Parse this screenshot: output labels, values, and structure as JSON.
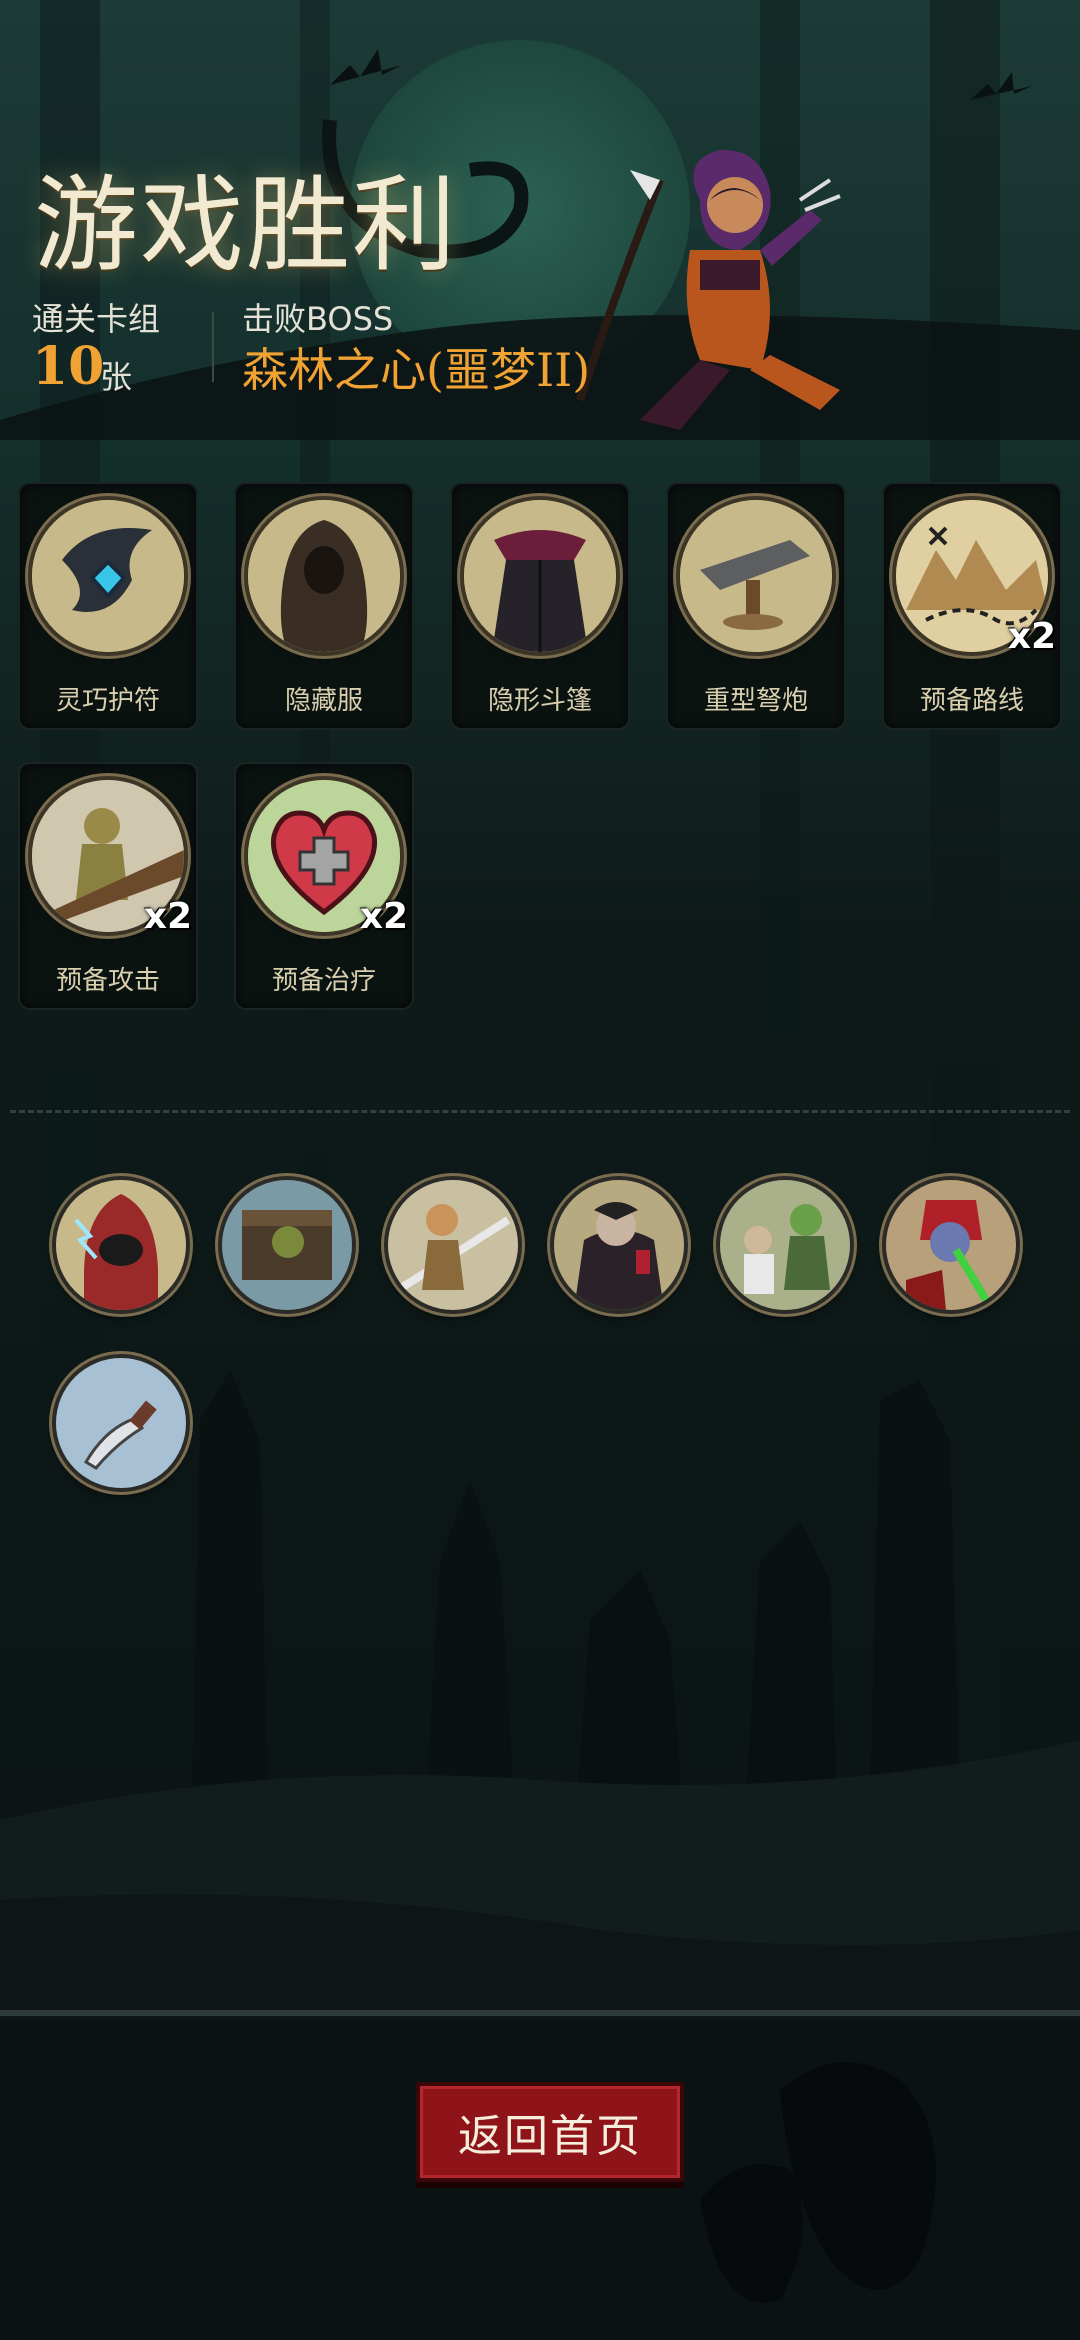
{
  "header": {
    "title": "游戏胜利",
    "cleared_deck_label": "通关卡组",
    "cleared_deck_count": "10",
    "cleared_deck_unit": "张",
    "defeated_boss_label": "击败BOSS",
    "defeated_boss_name": "森林之心(噩梦II)"
  },
  "reward_cards": [
    {
      "label": "灵巧护符",
      "icon": "winged-amulet-icon",
      "badge": ""
    },
    {
      "label": "隐藏服",
      "icon": "hooded-cloak-icon",
      "badge": ""
    },
    {
      "label": "隐形斗篷",
      "icon": "cape-icon",
      "badge": ""
    },
    {
      "label": "重型弩炮",
      "icon": "ballista-icon",
      "badge": ""
    },
    {
      "label": "预备路线",
      "icon": "treasure-map-icon",
      "badge": "x2"
    },
    {
      "label": "预备攻击",
      "icon": "goblin-attack-icon",
      "badge": "x2"
    },
    {
      "label": "预备治疗",
      "icon": "heart-cross-icon",
      "badge": "x2"
    }
  ],
  "relics": [
    {
      "icon": "red-hood-mage-icon"
    },
    {
      "icon": "treasure-chest-goblin-icon"
    },
    {
      "icon": "swordsman-icon"
    },
    {
      "icon": "vampire-icon"
    },
    {
      "icon": "zombie-icon"
    },
    {
      "icon": "demon-guitar-icon"
    },
    {
      "icon": "knife-icon"
    }
  ],
  "footer": {
    "home_button_label": "返回首页"
  },
  "colors": {
    "accent_orange": "#f0a232",
    "button_red": "#8e1419",
    "background": "#0d1616"
  }
}
